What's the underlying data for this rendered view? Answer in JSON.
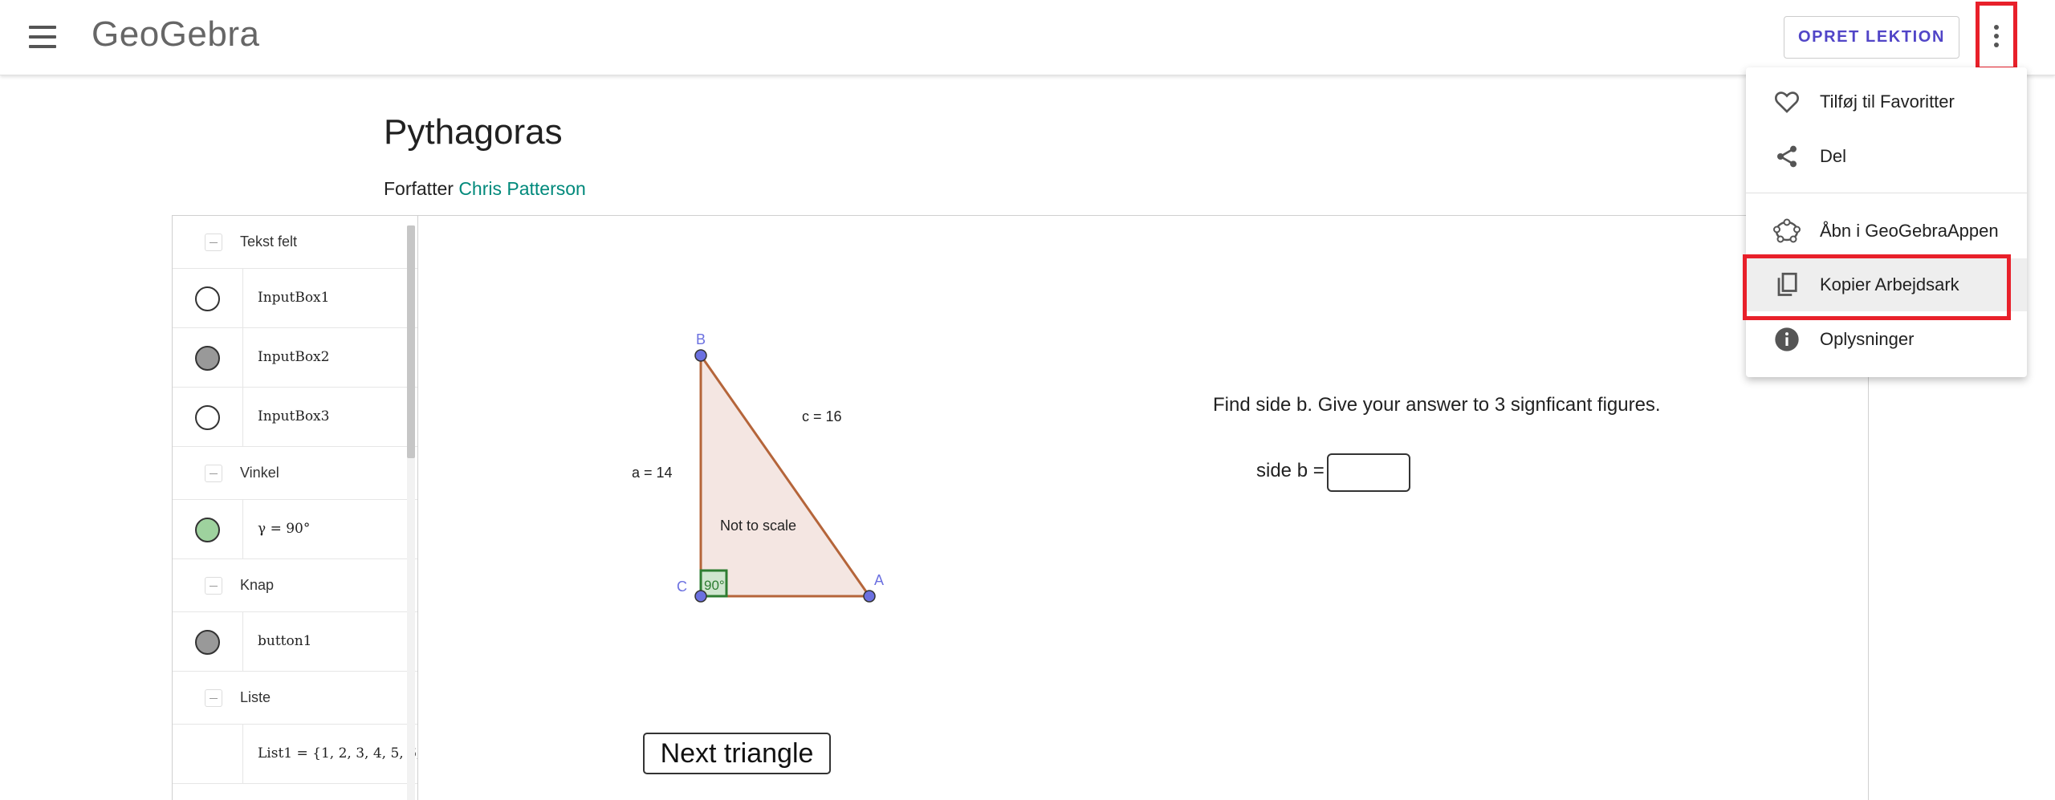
{
  "header": {
    "logo": "GeoGebra",
    "create_lesson": "OPRET LEKTION"
  },
  "page": {
    "title": "Pythagoras",
    "author_label": "Forfatter",
    "author_name": "Chris Patterson"
  },
  "algebra": {
    "items": [
      {
        "type": "section",
        "label": "Tekst felt"
      },
      {
        "type": "row",
        "label": "InputBox1",
        "marker": "#ffffff"
      },
      {
        "type": "row",
        "label": "InputBox2",
        "marker": "#999999"
      },
      {
        "type": "row",
        "label": "InputBox3",
        "marker": "#ffffff"
      },
      {
        "type": "section",
        "label": "Vinkel"
      },
      {
        "type": "row",
        "label": "γ = 90°",
        "marker": "#9ed29e"
      },
      {
        "type": "section",
        "label": "Knap"
      },
      {
        "type": "row",
        "label": "button1",
        "marker": "#999999"
      },
      {
        "type": "section",
        "label": "Liste"
      },
      {
        "type": "row",
        "label": "List1 = {1, 2, 3, 4, 5, 6,",
        "marker": null
      }
    ]
  },
  "graphics": {
    "label_B": "B",
    "label_A": "A",
    "label_C": "C",
    "label_a": "a = 14",
    "label_c": "c = 16",
    "label_not_to_scale": "Not to scale",
    "label_angle": "90°",
    "question": "Find side b. Give your answer to 3 signficant figures.",
    "side_b_label": "side b =",
    "next_button": "Next triangle"
  },
  "menu": {
    "items": [
      {
        "label": "Tilføj til Favoritter",
        "icon": "heart-icon"
      },
      {
        "label": "Del",
        "icon": "share-icon"
      },
      {
        "label": "Åbn i GeoGebraAppen",
        "icon": "geogebra-icon"
      },
      {
        "label": "Kopier Arbejdsark",
        "icon": "copy-icon"
      },
      {
        "label": "Oplysninger",
        "icon": "info-icon"
      }
    ]
  },
  "colors": {
    "accent": "#5145c7",
    "author_link": "#00897b",
    "highlight": "#e8202a",
    "triangle_stroke": "#b5653a",
    "triangle_fill": "#f4e6e2",
    "point": "#6b70e0"
  }
}
